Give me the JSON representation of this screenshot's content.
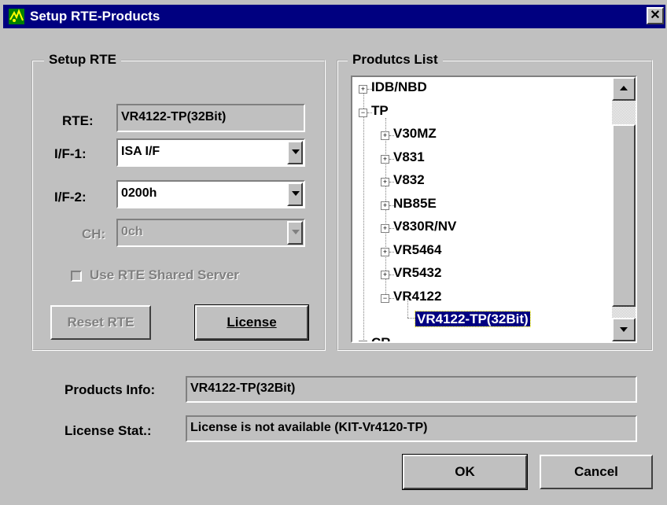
{
  "window": {
    "title": "Setup RTE-Products",
    "close_glyph": "✕"
  },
  "setup": {
    "group_title": "Setup RTE",
    "rte_label": "RTE:",
    "rte_value": "VR4122-TP(32Bit)",
    "if1_label": "I/F-1:",
    "if1_value": "ISA I/F",
    "if2_label": "I/F-2:",
    "if2_value": "0200h",
    "ch_label": "CH:",
    "ch_value": "0ch",
    "shared_server_label": "Use RTE Shared Server",
    "reset_button": "Reset RTE",
    "license_button": "License"
  },
  "products": {
    "group_title": "Produtcs List",
    "tree": [
      {
        "label": "IDB/NBD",
        "level": 0,
        "expander": "+"
      },
      {
        "label": "TP",
        "level": 0,
        "expander": "−"
      },
      {
        "label": "V30MZ",
        "level": 1,
        "expander": "+"
      },
      {
        "label": "V831",
        "level": 1,
        "expander": "+"
      },
      {
        "label": "V832",
        "level": 1,
        "expander": "+"
      },
      {
        "label": "NB85E",
        "level": 1,
        "expander": "+"
      },
      {
        "label": "V830R/NV",
        "level": 1,
        "expander": "+"
      },
      {
        "label": "VR5464",
        "level": 1,
        "expander": "+"
      },
      {
        "label": "VR5432",
        "level": 1,
        "expander": "+"
      },
      {
        "label": "VR4122",
        "level": 1,
        "expander": "−"
      },
      {
        "label": "VR4122-TP(32Bit)",
        "level": 2,
        "selected": true
      },
      {
        "label": "CR",
        "level": 0,
        "expander": "+"
      }
    ]
  },
  "info": {
    "products_info_label": "Products Info:",
    "products_info_value": "VR4122-TP(32Bit)",
    "license_stat_label": "License Stat.:",
    "license_stat_value": "License is not available (KIT-Vr4120-TP)"
  },
  "buttons": {
    "ok": "OK",
    "cancel": "Cancel"
  },
  "colors": {
    "titlebar": "#000080",
    "face": "#c0c0c0",
    "selection": "#000080"
  }
}
